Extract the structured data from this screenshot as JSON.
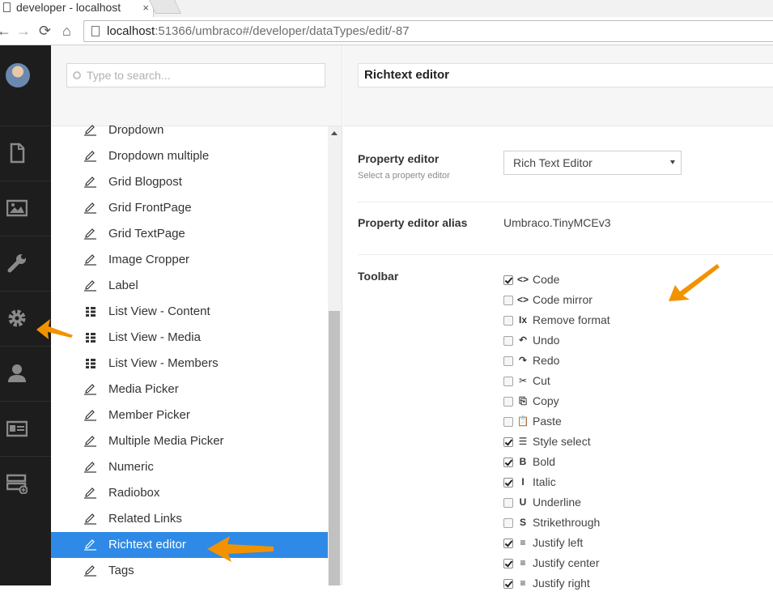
{
  "browser": {
    "tab_title": "developer - localhost",
    "tab_close": "×",
    "url_host": "localhost",
    "url_path": ":51366/umbraco#/developer/dataTypes/edit/-87"
  },
  "tree": {
    "search_placeholder": "Type to search...",
    "items": [
      {
        "label": "Dropdown",
        "icon": "pencil-icon"
      },
      {
        "label": "Dropdown multiple",
        "icon": "pencil-icon"
      },
      {
        "label": "Grid Blogpost",
        "icon": "pencil-icon"
      },
      {
        "label": "Grid FrontPage",
        "icon": "pencil-icon"
      },
      {
        "label": "Grid TextPage",
        "icon": "pencil-icon"
      },
      {
        "label": "Image Cropper",
        "icon": "pencil-icon"
      },
      {
        "label": "Label",
        "icon": "pencil-icon"
      },
      {
        "label": "List View - Content",
        "icon": "list-view-icon"
      },
      {
        "label": "List View - Media",
        "icon": "list-view-icon"
      },
      {
        "label": "List View - Members",
        "icon": "list-view-icon"
      },
      {
        "label": "Media Picker",
        "icon": "pencil-icon"
      },
      {
        "label": "Member Picker",
        "icon": "pencil-icon"
      },
      {
        "label": "Multiple Media Picker",
        "icon": "pencil-icon"
      },
      {
        "label": "Numeric",
        "icon": "pencil-icon"
      },
      {
        "label": "Radiobox",
        "icon": "pencil-icon"
      },
      {
        "label": "Related Links",
        "icon": "pencil-icon"
      },
      {
        "label": "Richtext editor",
        "icon": "pencil-icon",
        "active": true
      },
      {
        "label": "Tags",
        "icon": "pencil-icon"
      }
    ]
  },
  "editor": {
    "name": "Richtext editor",
    "property_editor_label": "Property editor",
    "property_editor_desc": "Select a property editor",
    "property_editor_value": "Rich Text Editor",
    "alias_label": "Property editor alias",
    "alias_value": "Umbraco.TinyMCEv3",
    "toolbar_label": "Toolbar",
    "toolbar_items": [
      {
        "label": "Code",
        "glyph": "<>",
        "checked": true
      },
      {
        "label": "Code mirror",
        "glyph": "<>",
        "checked": false
      },
      {
        "label": "Remove format",
        "glyph": "Ix",
        "checked": false
      },
      {
        "label": "Undo",
        "glyph": "↶",
        "checked": false
      },
      {
        "label": "Redo",
        "glyph": "↷",
        "checked": false
      },
      {
        "label": "Cut",
        "glyph": "✂",
        "checked": false
      },
      {
        "label": "Copy",
        "glyph": "⎘",
        "checked": false
      },
      {
        "label": "Paste",
        "glyph": "📋",
        "checked": false
      },
      {
        "label": "Style select",
        "glyph": "☰",
        "checked": true
      },
      {
        "label": "Bold",
        "glyph": "B",
        "checked": true
      },
      {
        "label": "Italic",
        "glyph": "I",
        "checked": true
      },
      {
        "label": "Underline",
        "glyph": "U",
        "checked": false
      },
      {
        "label": "Strikethrough",
        "glyph": "S",
        "checked": false
      },
      {
        "label": "Justify left",
        "glyph": "≡",
        "checked": true
      },
      {
        "label": "Justify center",
        "glyph": "≡",
        "checked": true
      },
      {
        "label": "Justify right",
        "glyph": "≡",
        "checked": true
      }
    ]
  },
  "colors": {
    "sections_bg": "#1d1d1d",
    "active_item": "#2e8ae6",
    "arrow": "#f39200"
  }
}
